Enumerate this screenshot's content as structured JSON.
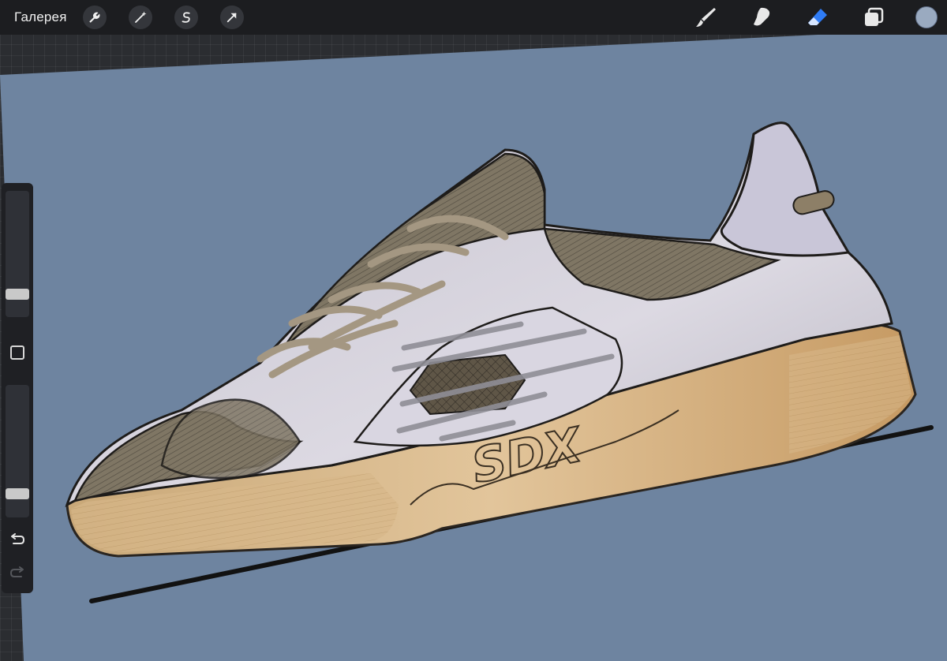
{
  "toolbar": {
    "gallery_label": "Галерея",
    "left_icons": [
      "wrench-icon",
      "magic-wand-icon",
      "selection-icon",
      "transform-arrow-icon"
    ],
    "right_icons": [
      "brush-icon",
      "smudge-icon",
      "eraser-icon",
      "layers-icon"
    ],
    "active_tool": "eraser",
    "active_color": "#9aaac0",
    "active_tool_color": "#2f7cf6"
  },
  "sidebar": {
    "brush_size_level": 0.15,
    "opacity_level": 0.15,
    "icons": [
      "modify-square-icon",
      "undo-icon",
      "redo-icon"
    ]
  },
  "canvas": {
    "background_color": "#6e84a0",
    "sole_text": "SDX"
  }
}
